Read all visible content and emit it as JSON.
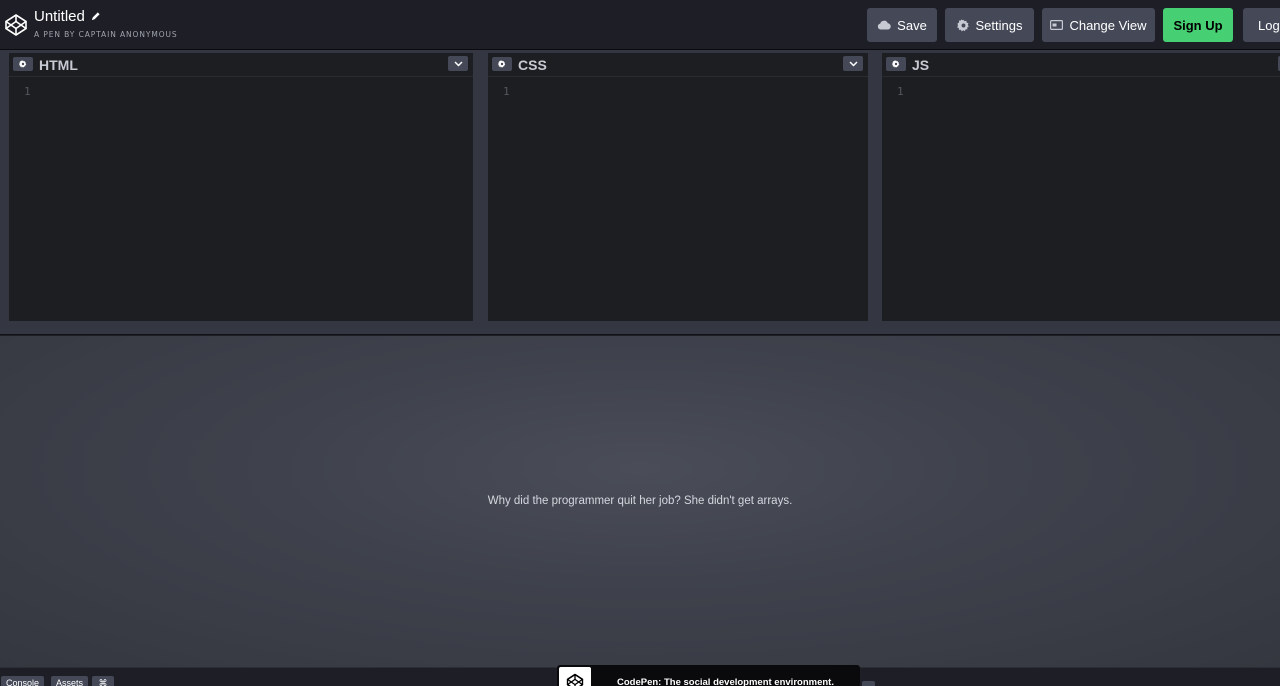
{
  "header": {
    "title": "Untitled",
    "subtitle": "A PEN BY CAPTAIN ANONYMOUS",
    "buttons": {
      "save": "Save",
      "settings": "Settings",
      "change_view": "Change View",
      "sign_up": "Sign Up",
      "login": "Log"
    }
  },
  "editors": [
    {
      "name": "HTML",
      "line": "1"
    },
    {
      "name": "CSS",
      "line": "1"
    },
    {
      "name": "JS",
      "line": "1"
    }
  ],
  "preview": {
    "text": "Why did the programmer quit her job? She didn't get arrays."
  },
  "footer": {
    "console": "Console",
    "assets": "Assets",
    "shortcuts": "⌘"
  },
  "promo": {
    "text": "CodePen: The social development environment."
  },
  "colors": {
    "accent_green": "#47cf73",
    "button_bg": "#444857",
    "editor_bg": "#1d1e22"
  }
}
